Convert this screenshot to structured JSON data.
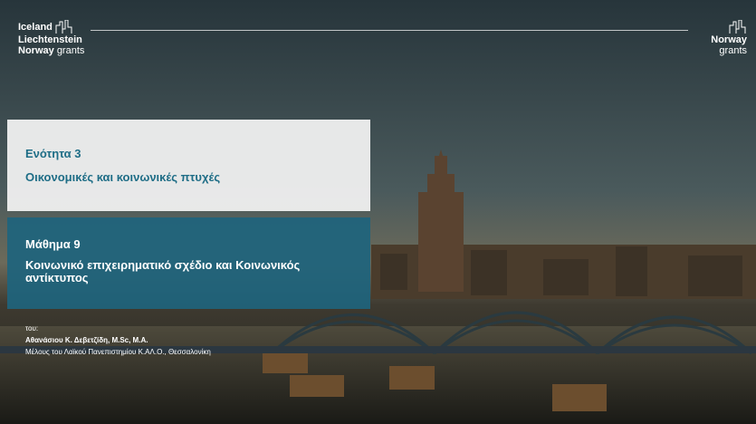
{
  "logo_left": {
    "line1": "Iceland",
    "line2": "Liechtenstein",
    "line3_bold": "Norway",
    "line3_light": "grants"
  },
  "logo_right": {
    "line1": "Norway",
    "line2": "grants"
  },
  "unit": {
    "label": "Ενότητα 3",
    "title": "Οικονομικές και κοινωνικές πτυχές"
  },
  "lesson": {
    "label": "Μάθημα 9",
    "title": "Κοινωνικό επιχειρηματικό σχέδιο και Κοινωνικός αντίκτυπος"
  },
  "author": {
    "by": "του:",
    "name": "Αθανάσιου Κ. Δεβετζίδη, M.Sc, M.A.",
    "affiliation": "Μέλους του Λαϊκού Πανεπιστημίου Κ.ΑΛ.Ο., Θεσσαλονίκη"
  },
  "colors": {
    "accent": "#1e6d86",
    "panel_teal": "#1e647d",
    "panel_white": "#f0f0f0"
  }
}
